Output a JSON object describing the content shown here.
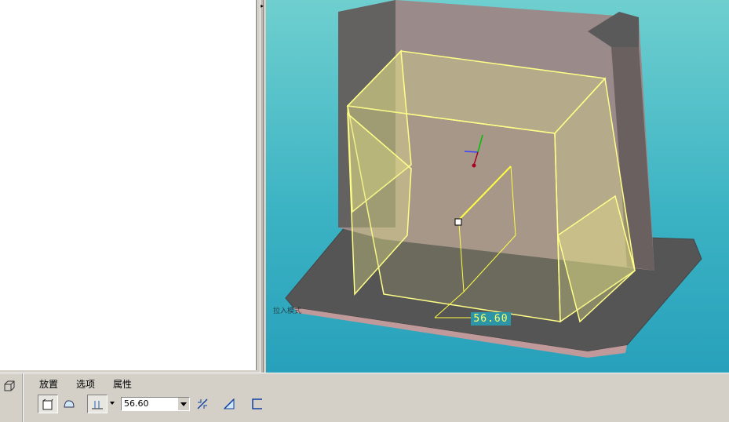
{
  "dashboard": {
    "tabs": [
      {
        "label": "放置"
      },
      {
        "label": "选项"
      },
      {
        "label": "属性"
      }
    ],
    "depth_value": "56.60",
    "tools": [
      {
        "icon": "solid-icon",
        "pressed": true
      },
      {
        "icon": "surface-icon",
        "pressed": false
      },
      {
        "icon": "depth-type-icon",
        "pressed": true
      },
      {
        "icon": "flip-direction-icon",
        "pressed": false
      },
      {
        "icon": "remove-material-icon",
        "pressed": false
      },
      {
        "icon": "thicken-icon",
        "pressed": false
      }
    ]
  },
  "viewport": {
    "dimension_value": "56.60",
    "small_label": "拉入模式"
  },
  "colors": {
    "viewport_top": "#6fcfcf",
    "viewport_bottom": "#27a0bb",
    "base_plate": "#555555",
    "back_wall": "#9a8a89",
    "preview_yellow": "#ffff88"
  }
}
